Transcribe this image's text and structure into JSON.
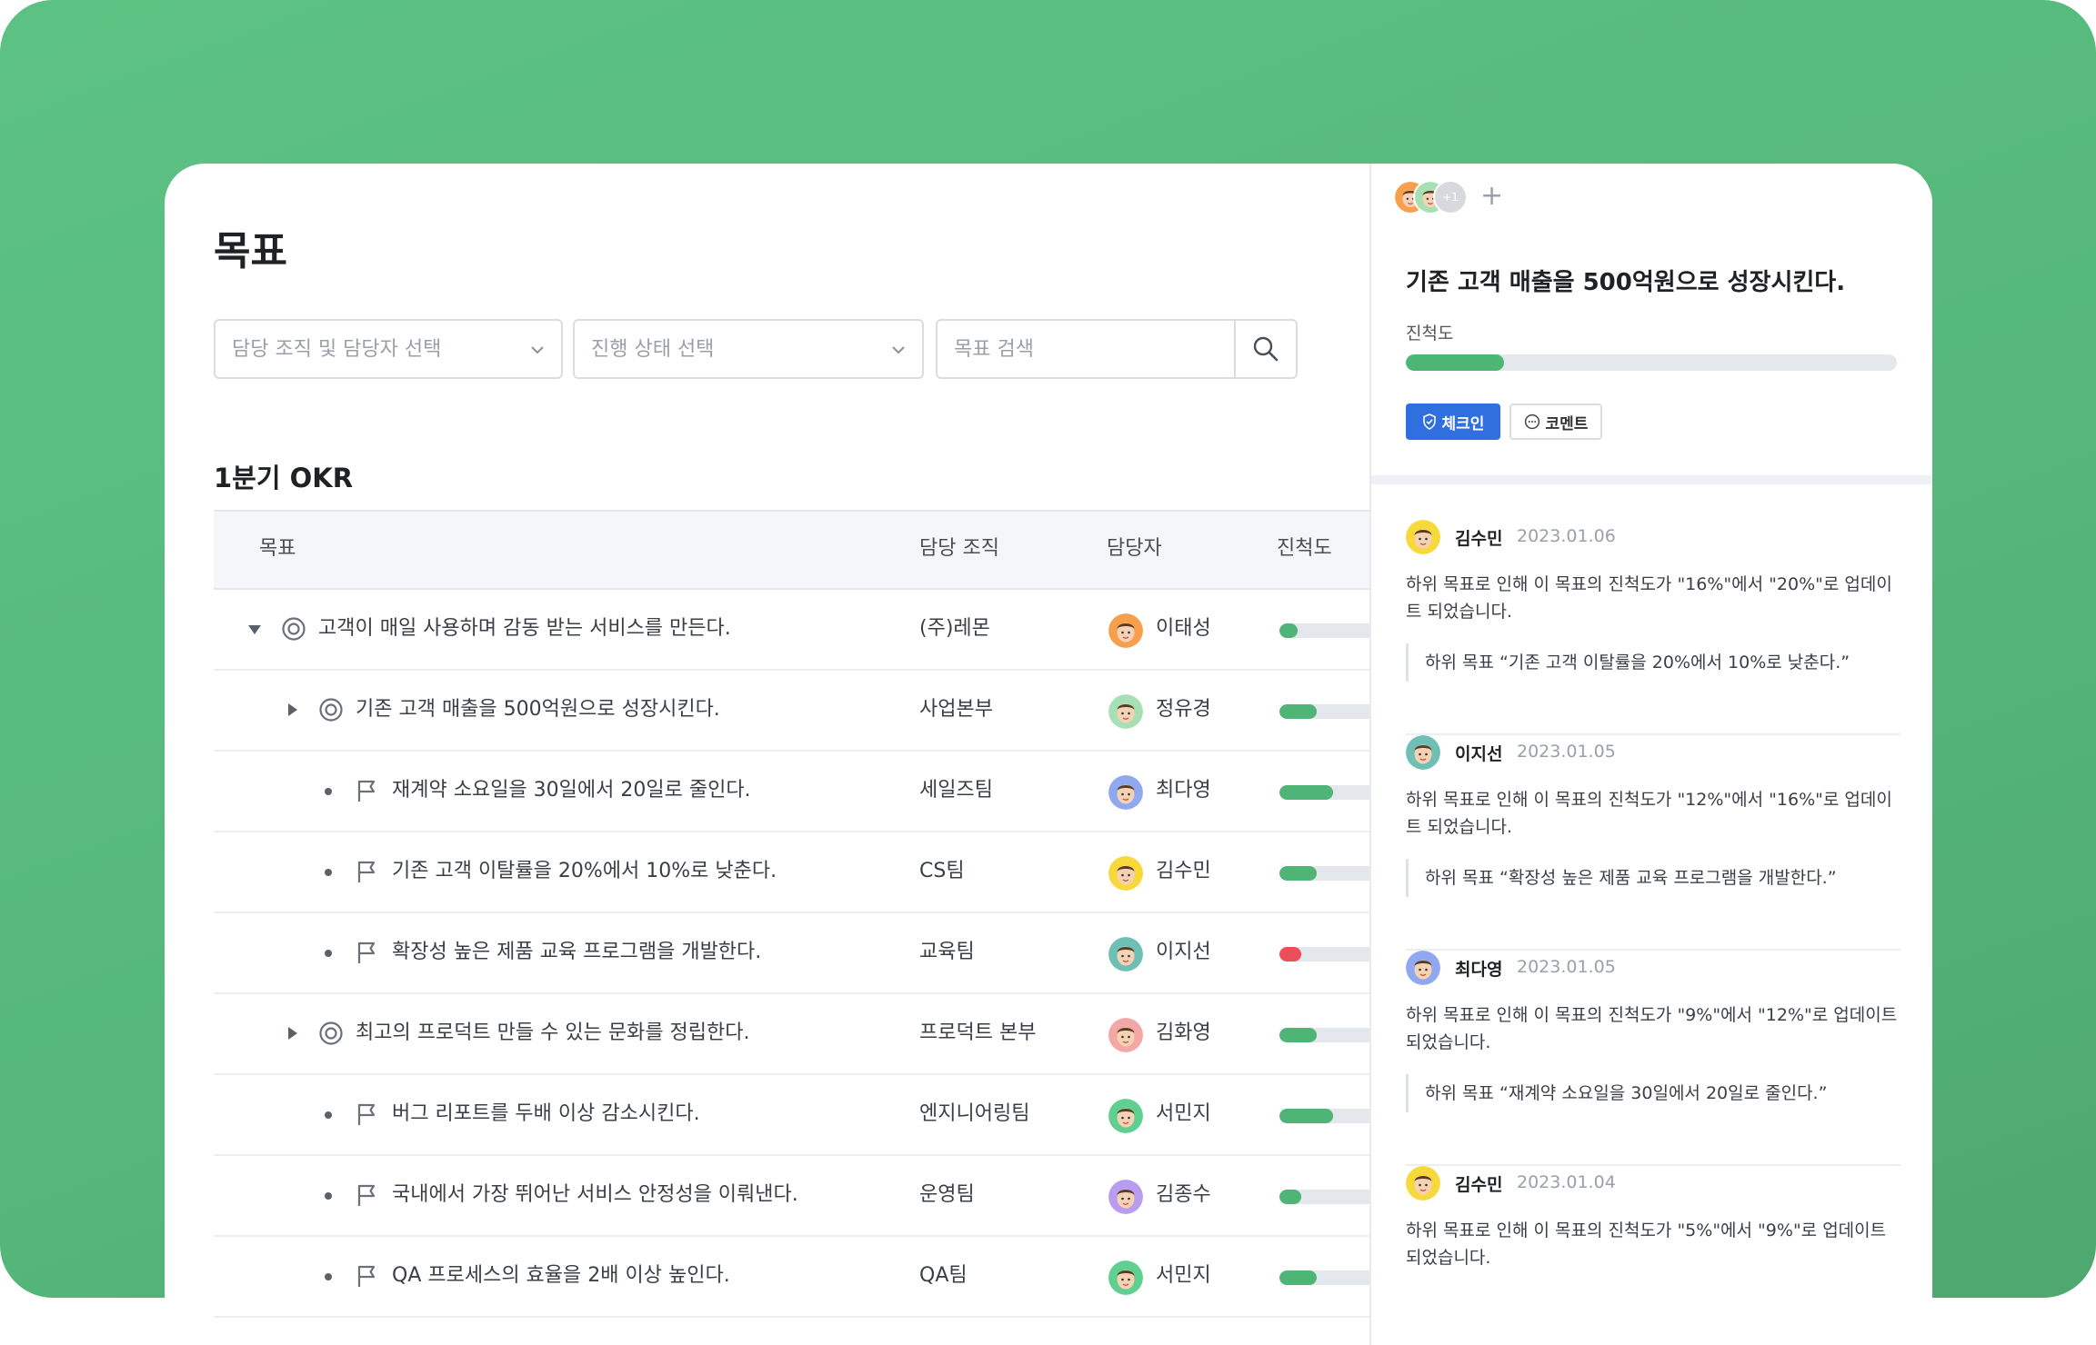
{
  "page": {
    "title": "목표"
  },
  "filters": {
    "org_placeholder": "담당 조직 및 담당자 선택",
    "status_placeholder": "진행 상태 선택",
    "search_placeholder": "목표 검색"
  },
  "section": {
    "title": "1분기 OKR"
  },
  "table": {
    "headers": {
      "goal": "목표",
      "org": "담당 조직",
      "owner": "담당자",
      "progress": "진척도"
    },
    "rows": [
      {
        "level": 0,
        "toggle": "expanded",
        "icon": "target-icon",
        "title": "고객이 매일 사용하며 감동 받는 서비스를 만든다.",
        "org": "(주)레몬",
        "owner": "이태성",
        "avatar_color": "#f6a04d",
        "progress": 0.14,
        "bar_color": "#4fb577"
      },
      {
        "level": 1,
        "toggle": "collapsed",
        "icon": "target-icon",
        "title": "기존 고객 매출을 500억원으로 성장시킨다.",
        "org": "사업본부",
        "owner": "정유경",
        "avatar_color": "#a8e0b5",
        "progress": 0.29,
        "bar_color": "#4fb577"
      },
      {
        "level": 2,
        "toggle": "bullet",
        "icon": "flag-icon",
        "title": "재계약 소요일을 30일에서 20일로 줄인다.",
        "org": "세일즈팀",
        "owner": "최다영",
        "avatar_color": "#8fa8f0",
        "progress": 0.42,
        "bar_color": "#4fb577"
      },
      {
        "level": 2,
        "toggle": "bullet",
        "icon": "flag-icon",
        "title": "기존 고객 이탈률을 20%에서 10%로 낮춘다.",
        "org": "CS팀",
        "owner": "김수민",
        "avatar_color": "#f7d93b",
        "progress": 0.29,
        "bar_color": "#4fb577"
      },
      {
        "level": 2,
        "toggle": "bullet",
        "icon": "flag-icon",
        "title": "확장성 높은 제품 교육 프로그램을 개발한다.",
        "org": "교육팀",
        "owner": "이지선",
        "avatar_color": "#6fc0b4",
        "progress": 0.17,
        "bar_color": "#ee4d5a"
      },
      {
        "level": 1,
        "toggle": "collapsed",
        "icon": "target-icon",
        "title": "최고의 프로덕트 만들 수 있는 문화를 정립한다.",
        "org": "프로덕트 본부",
        "owner": "김화영",
        "avatar_color": "#f4a7a7",
        "progress": 0.29,
        "bar_color": "#4fb577"
      },
      {
        "level": 2,
        "toggle": "bullet",
        "icon": "flag-icon",
        "title": "버그 리포트를 두배 이상 감소시킨다.",
        "org": "엔지니어링팀",
        "owner": "서민지",
        "avatar_color": "#5fd08f",
        "progress": 0.42,
        "bar_color": "#4fb577"
      },
      {
        "level": 2,
        "toggle": "bullet",
        "icon": "flag-icon",
        "title": "국내에서 가장 뛰어난 서비스 안정성을 이뤄낸다.",
        "org": "운영팀",
        "owner": "김종수",
        "avatar_color": "#b79cf0",
        "progress": 0.17,
        "bar_color": "#4fb577"
      },
      {
        "level": 2,
        "toggle": "bullet",
        "icon": "flag-icon",
        "title": "QA 프로세스의 효율을 2배 이상 높인다.",
        "org": "QA팀",
        "owner": "서민지",
        "avatar_color": "#5fd08f",
        "progress": 0.29,
        "bar_color": "#4fb577"
      }
    ]
  },
  "panel": {
    "member_avatars": [
      {
        "name": "member-1",
        "color": "#f6a04d"
      },
      {
        "name": "member-2",
        "color": "#a8e0b5"
      }
    ],
    "more_count": "+1",
    "add_symbol": "+",
    "title": "기존 고객 매출을 500억원으로 성장시킨다.",
    "progress_label": "진척도",
    "progress": 0.2,
    "checkin_label": "체크인",
    "comment_label": "코멘트",
    "feed": [
      {
        "name": "김수민",
        "date": "2023.01.06",
        "avatar_color": "#f7d93b",
        "text": "하위 목표로 인해 이 목표의 진척도가 \"16%\"에서 \"20%\"로 업데이트 되었습니다.",
        "quote": "하위 목표 “기존 고객 이탈률을 20%에서 10%로 낮춘다.”"
      },
      {
        "name": "이지선",
        "date": "2023.01.05",
        "avatar_color": "#6fc0b4",
        "text": "하위 목표로 인해 이 목표의 진척도가 \"12%\"에서 \"16%\"로 업데이트 되었습니다.",
        "quote": "하위 목표 “확장성 높은 제품 교육 프로그램을 개발한다.”"
      },
      {
        "name": "최다영",
        "date": "2023.01.05",
        "avatar_color": "#8fa8f0",
        "text": "하위 목표로 인해 이 목표의 진척도가 \"9%\"에서 \"12%\"로 업데이트 되었습니다.",
        "quote": "하위 목표 “재계약 소요일을 30일에서 20일로 줄인다.”"
      },
      {
        "name": "김수민",
        "date": "2023.01.04",
        "avatar_color": "#f7d93b",
        "text": "하위 목표로 인해 이 목표의 진척도가 \"5%\"에서 \"9%\"로 업데이트 되었습니다.",
        "quote": ""
      }
    ]
  }
}
